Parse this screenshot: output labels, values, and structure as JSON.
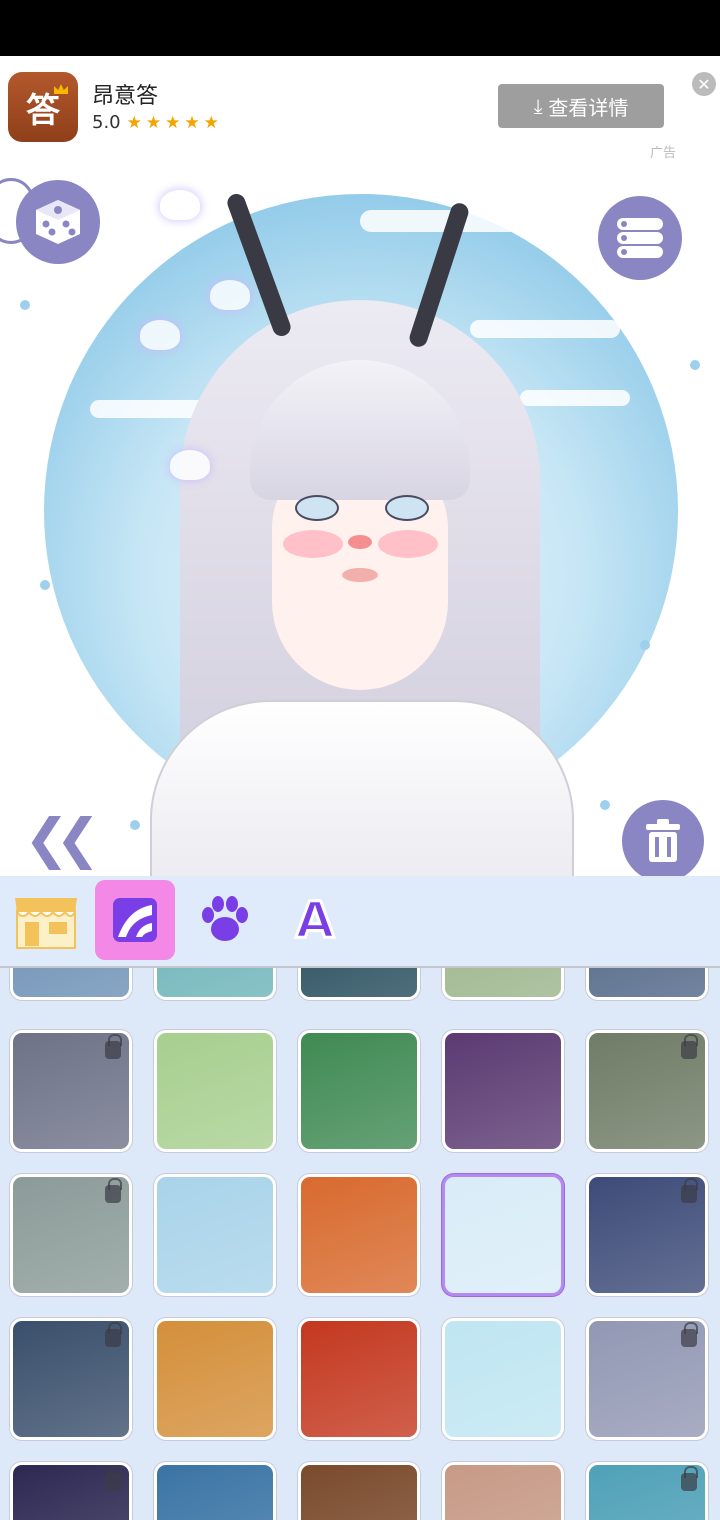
{
  "ad": {
    "app_name": "昂意答",
    "icon_glyph": "答",
    "rating": "5.0",
    "stars": "★★★★★",
    "cta_label": "查看详情",
    "download_icon": "⤓",
    "close_glyph": "✕",
    "ad_tag": "广告"
  },
  "stage": {
    "back_glyph": "«",
    "icons": [
      "dice-icon",
      "list-menu-icon",
      "trash-icon",
      "double-chevron-left-icon"
    ]
  },
  "tabs": [
    {
      "name": "shop",
      "icon": "shop-icon",
      "active": false
    },
    {
      "name": "background",
      "icon": "background-icon",
      "active": true
    },
    {
      "name": "pet",
      "icon": "paw-icon",
      "active": false
    },
    {
      "name": "text",
      "icon": "text-icon",
      "label": "A",
      "active": false
    }
  ],
  "tiles": [
    {
      "row": 0,
      "col": 0,
      "bg": "#6b8fb5",
      "locked": false
    },
    {
      "row": 0,
      "col": 1,
      "bg": "#6bb3b8",
      "locked": false
    },
    {
      "row": 0,
      "col": 2,
      "bg": "#234a5a",
      "locked": false
    },
    {
      "row": 0,
      "col": 3,
      "bg": "#9ab48a",
      "locked": false
    },
    {
      "row": 0,
      "col": 4,
      "bg": "#4f6585",
      "locked": false
    },
    {
      "row": 1,
      "col": 0,
      "bg": "#6e7288",
      "locked": true
    },
    {
      "row": 1,
      "col": 1,
      "bg": "#a7cf8f",
      "locked": false
    },
    {
      "row": 1,
      "col": 2,
      "bg": "#3f8a53",
      "locked": false
    },
    {
      "row": 1,
      "col": 3,
      "bg": "#5b3a72",
      "locked": false
    },
    {
      "row": 1,
      "col": 4,
      "bg": "#6f7c66",
      "locked": true
    },
    {
      "row": 2,
      "col": 0,
      "bg": "#8b9b98",
      "locked": true
    },
    {
      "row": 2,
      "col": 1,
      "bg": "#a9d3ea",
      "locked": false
    },
    {
      "row": 2,
      "col": 2,
      "bg": "#d86a2e",
      "locked": false
    },
    {
      "row": 2,
      "col": 3,
      "bg": "#d9ecf8",
      "locked": false,
      "selected": true
    },
    {
      "row": 2,
      "col": 4,
      "bg": "#3d4b78",
      "locked": true
    },
    {
      "row": 3,
      "col": 0,
      "bg": "#3a4f6c",
      "locked": true
    },
    {
      "row": 3,
      "col": 1,
      "bg": "#d48f3a",
      "locked": false
    },
    {
      "row": 3,
      "col": 2,
      "bg": "#c4381f",
      "locked": false
    },
    {
      "row": 3,
      "col": 3,
      "bg": "#bfe6f2",
      "locked": false
    },
    {
      "row": 3,
      "col": 4,
      "bg": "#9298b4",
      "locked": true
    },
    {
      "row": 4,
      "col": 0,
      "bg": "#2d2852",
      "locked": true
    },
    {
      "row": 4,
      "col": 1,
      "bg": "#3a74a5",
      "locked": false
    },
    {
      "row": 4,
      "col": 2,
      "bg": "#7a4a2c",
      "locked": false
    },
    {
      "row": 4,
      "col": 3,
      "bg": "#c79a86",
      "locked": false
    },
    {
      "row": 4,
      "col": 4,
      "bg": "#4fa1b8",
      "locked": true
    }
  ],
  "colors": {
    "accent": "#8a86c4",
    "active_tab": "#f388e6",
    "selected_tile_border": "#b58af0",
    "tab_icon_purple": "#7a3ee6"
  }
}
